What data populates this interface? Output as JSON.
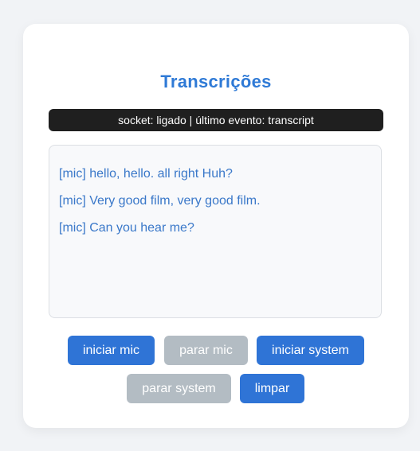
{
  "page": {
    "title": "Transcrições",
    "status": "socket: ligado | último evento: transcript"
  },
  "transcripts": [
    "[mic] hello, hello. all right Huh?",
    "[mic] Very good film, very good film.",
    "[mic] Can you hear me?"
  ],
  "controls": {
    "start_mic": "iniciar mic",
    "stop_mic": "parar mic",
    "start_system": "iniciar system",
    "stop_system": "parar system",
    "clear": "limpar"
  },
  "colors": {
    "accent": "#2f74d6",
    "disabled": "#b3bcc3",
    "status_bg": "#1f1f1f"
  }
}
